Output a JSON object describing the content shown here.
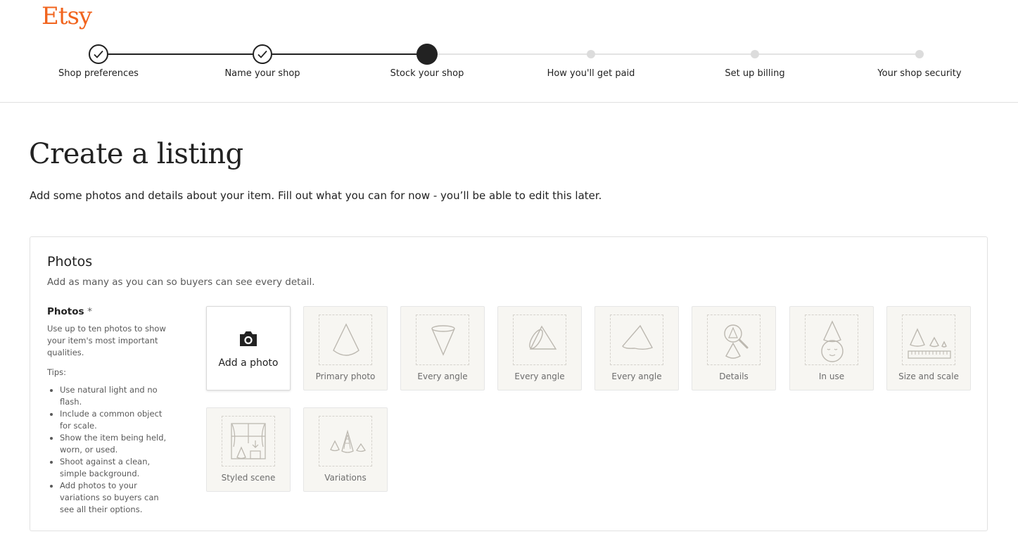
{
  "brand": {
    "logo_text": "Etsy",
    "color": "#f1641e"
  },
  "stepper": {
    "steps": [
      {
        "label": "Shop preferences",
        "status": "complete"
      },
      {
        "label": "Name your shop",
        "status": "complete"
      },
      {
        "label": "Stock your shop",
        "status": "current"
      },
      {
        "label": "How you'll get paid",
        "status": "upcoming"
      },
      {
        "label": "Set up billing",
        "status": "upcoming"
      },
      {
        "label": "Your shop security",
        "status": "upcoming"
      }
    ]
  },
  "page": {
    "title": "Create a listing",
    "subtitle": "Add some photos and details about your item. Fill out what you can for now - you’ll be able to edit this later."
  },
  "photos_section": {
    "title": "Photos",
    "subtitle": "Add as many as you can so buyers can see every detail.",
    "field_label": "Photos",
    "required_mark": "*",
    "description": "Use up to ten photos to show your item's most important qualities.",
    "tips_title": "Tips:",
    "tips": [
      "Use natural light and no flash.",
      "Include a common object for scale.",
      "Show the item being held, worn, or used.",
      "Shoot against a clean, simple background.",
      "Add photos to your variations so buyers can see all their options."
    ],
    "add_photo_label": "Add a photo",
    "slots": [
      {
        "label": "Primary photo",
        "icon": "cone-icon"
      },
      {
        "label": "Every angle",
        "icon": "cone-inverted-icon"
      },
      {
        "label": "Every angle",
        "icon": "cone-side-icon"
      },
      {
        "label": "Every angle",
        "icon": "cone-tilted-icon"
      },
      {
        "label": "Details",
        "icon": "magnifier-icon"
      },
      {
        "label": "In use",
        "icon": "cone-hat-face-icon"
      },
      {
        "label": "Size and scale",
        "icon": "ruler-icon"
      },
      {
        "label": "Styled scene",
        "icon": "window-scene-icon"
      },
      {
        "label": "Variations",
        "icon": "cones-variations-icon"
      }
    ]
  }
}
